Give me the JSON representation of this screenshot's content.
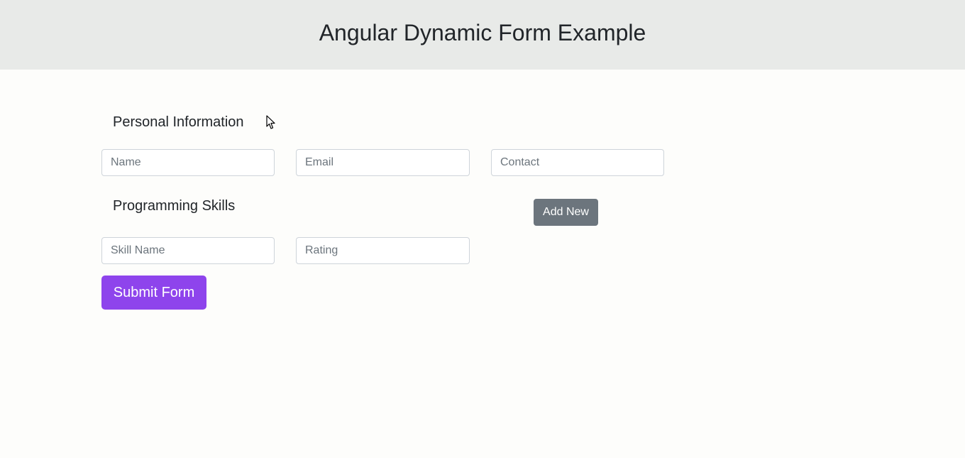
{
  "header": {
    "title": "Angular Dynamic Form Example"
  },
  "personal": {
    "title": "Personal Information",
    "name_placeholder": "Name",
    "email_placeholder": "Email",
    "contact_placeholder": "Contact"
  },
  "skills": {
    "title": "Programming Skills",
    "add_label": "Add New",
    "skill_placeholder": "Skill Name",
    "rating_placeholder": "Rating"
  },
  "form": {
    "submit_label": "Submit Form"
  },
  "colors": {
    "header_bg": "#e8eae8",
    "page_bg": "#fdfdfb",
    "add_button": "#6c757d",
    "submit_button": "#8e44ec"
  },
  "icons": {
    "cursor": "mouse-pointer-icon"
  }
}
